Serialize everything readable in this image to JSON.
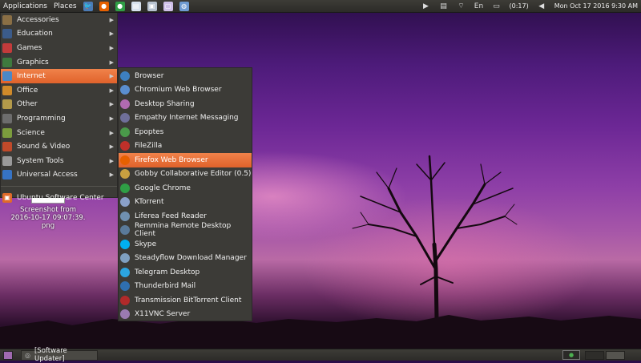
{
  "top_panel": {
    "applications_label": "Applications",
    "places_label": "Places",
    "launchers": [
      {
        "name": "pidgin-icon",
        "glyph": "🐦",
        "color": "#4b7bb5"
      },
      {
        "name": "firefox-icon",
        "glyph": "●",
        "color": "#e66000"
      },
      {
        "name": "chrome-icon",
        "glyph": "●",
        "color": "#2f9e45"
      },
      {
        "name": "document-icon",
        "glyph": "▤",
        "color": "#d8e2ee"
      },
      {
        "name": "image-viewer-icon",
        "glyph": "▣",
        "color": "#b7c2cf"
      },
      {
        "name": "monitor-icon",
        "glyph": "▢",
        "color": "#cfc0e8"
      },
      {
        "name": "globe-icon",
        "glyph": "◍",
        "color": "#6f9bd2"
      }
    ],
    "tray": {
      "battery_text": "(0:17)",
      "datetime": "Mon Oct 17 2016  9:30 AM"
    }
  },
  "menu": {
    "items": [
      {
        "label": "Accessories",
        "icon": "accessories-icon",
        "color": "#8a6f45",
        "has_submenu": true
      },
      {
        "label": "Education",
        "icon": "education-icon",
        "color": "#3b5b8a",
        "has_submenu": true
      },
      {
        "label": "Games",
        "icon": "games-icon",
        "color": "#c43b3b",
        "has_submenu": true
      },
      {
        "label": "Graphics",
        "icon": "graphics-icon",
        "color": "#3e7a3e",
        "has_submenu": true
      },
      {
        "label": "Internet",
        "icon": "internet-icon",
        "color": "#4a88c7",
        "has_submenu": true,
        "active": true
      },
      {
        "label": "Office",
        "icon": "office-icon",
        "color": "#d08a2a",
        "has_submenu": true
      },
      {
        "label": "Other",
        "icon": "other-icon",
        "color": "#b49a4a",
        "has_submenu": true
      },
      {
        "label": "Programming",
        "icon": "programming-icon",
        "color": "#6d6d6d",
        "has_submenu": true
      },
      {
        "label": "Science",
        "icon": "science-icon",
        "color": "#7c9d3d",
        "has_submenu": true
      },
      {
        "label": "Sound & Video",
        "icon": "sound-video-icon",
        "color": "#c04a2a",
        "has_submenu": true
      },
      {
        "label": "System Tools",
        "icon": "system-tools-icon",
        "color": "#9a9a9a",
        "has_submenu": true
      },
      {
        "label": "Universal Access",
        "icon": "universal-access-icon",
        "color": "#3673c4",
        "has_submenu": true
      }
    ],
    "software_center": {
      "label": "Ubuntu Software Center",
      "icon": "software-center-icon",
      "color": "#e06a2a"
    }
  },
  "submenu": {
    "items": [
      {
        "label": "Browser",
        "icon": "browser-icon",
        "color": "#3d7fc0"
      },
      {
        "label": "Chromium Web Browser",
        "icon": "chromium-icon",
        "color": "#5a8ed0"
      },
      {
        "label": "Desktop Sharing",
        "icon": "desktop-sharing-icon",
        "color": "#b06ab0"
      },
      {
        "label": "Empathy Internet Messaging",
        "icon": "empathy-icon",
        "color": "#6f6f9a"
      },
      {
        "label": "Epoptes",
        "icon": "epoptes-icon",
        "color": "#4a9a4a"
      },
      {
        "label": "FileZilla",
        "icon": "filezilla-icon",
        "color": "#c0302a"
      },
      {
        "label": "Firefox Web Browser",
        "icon": "firefox-icon",
        "color": "#e66000",
        "active": true
      },
      {
        "label": "Gobby Collaborative Editor (0.5)",
        "icon": "gobby-icon",
        "color": "#c8a040"
      },
      {
        "label": "Google Chrome",
        "icon": "google-chrome-icon",
        "color": "#2f9e45"
      },
      {
        "label": "KTorrent",
        "icon": "ktorrent-icon",
        "color": "#8aa0c8"
      },
      {
        "label": "Liferea Feed Reader",
        "icon": "liferea-icon",
        "color": "#7090b0"
      },
      {
        "label": "Remmina Remote Desktop Client",
        "icon": "remmina-icon",
        "color": "#5a7a9a"
      },
      {
        "label": "Skype",
        "icon": "skype-icon",
        "color": "#00aff0"
      },
      {
        "label": "Steadyflow Download Manager",
        "icon": "steadyflow-icon",
        "color": "#7fa0c0"
      },
      {
        "label": "Telegram Desktop",
        "icon": "telegram-icon",
        "color": "#2ca5e0"
      },
      {
        "label": "Thunderbird Mail",
        "icon": "thunderbird-icon",
        "color": "#2f6fb0"
      },
      {
        "label": "Transmission BitTorrent Client",
        "icon": "transmission-icon",
        "color": "#b02a2a"
      },
      {
        "label": "X11VNC Server",
        "icon": "x11vnc-icon",
        "color": "#9a7ab0"
      }
    ]
  },
  "desktop": {
    "file_label_line1": "Screenshot from",
    "file_label_line2": "2016-10-17 09:07:39.",
    "file_label_line3": "png"
  },
  "bottom_panel": {
    "task_label": "[Software Updater]"
  }
}
